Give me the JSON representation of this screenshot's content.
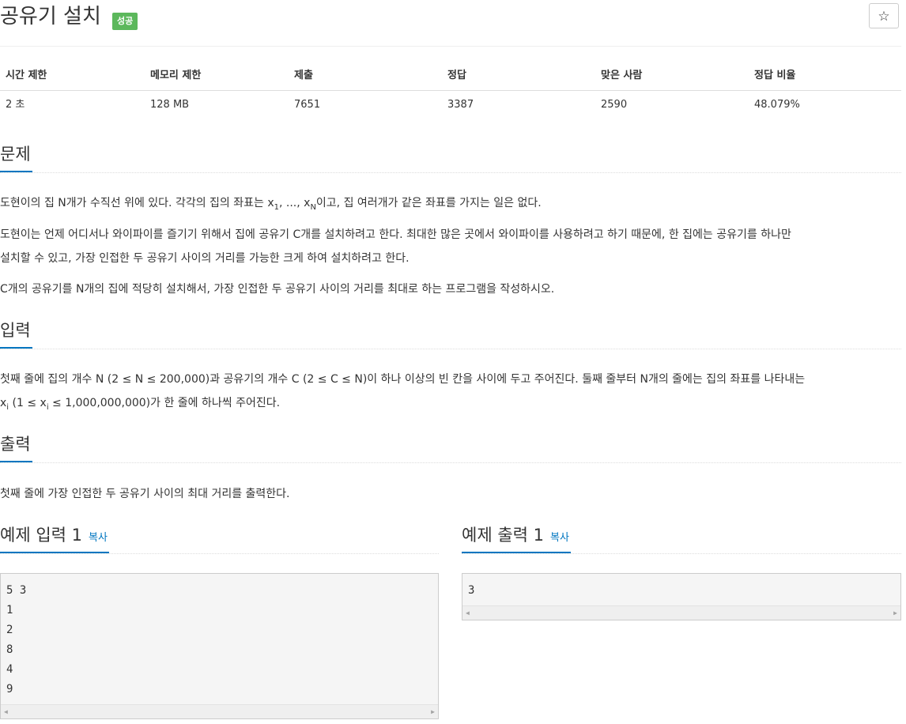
{
  "header": {
    "title": "공유기 설치",
    "badge": "성공",
    "star_icon": "☆"
  },
  "info_table": {
    "headers": [
      "시간 제한",
      "메모리 제한",
      "제출",
      "정답",
      "맞은 사람",
      "정답 비율"
    ],
    "values": [
      "2 초",
      "128 MB",
      "7651",
      "3387",
      "2590",
      "48.079%"
    ]
  },
  "sections": {
    "problem": {
      "title": "문제",
      "p1_a": "도현이의 집 N개가 수직선 위에 있다. 각각의 집의 좌표는 x",
      "p1_sub1": "1",
      "p1_b": ", ..., x",
      "p1_subN": "N",
      "p1_c": "이고, 집 여러개가 같은 좌표를 가지는 일은 없다.",
      "p2_line1": "도현이는 언제 어디서나 와이파이를 즐기기 위해서 집에 공유기 C개를 설치하려고 한다. 최대한 많은 곳에서 와이파이를 사용하려고 하기 때문에, 한 집에는 공유기를 하나만",
      "p2_line2": "설치할 수 있고, 가장 인접한 두 공유기 사이의 거리를 가능한 크게 하여 설치하려고 한다.",
      "p3": "C개의 공유기를 N개의 집에 적당히 설치해서, 가장 인접한 두 공유기 사이의 거리를 최대로 하는 프로그램을 작성하시오."
    },
    "input": {
      "title": "입력",
      "line1": "첫째 줄에 집의 개수 N (2 ≤ N ≤ 200,000)과 공유기의 개수 C (2 ≤ C ≤ N)이 하나 이상의 빈 칸을 사이에 두고 주어진다. 둘째 줄부터 N개의 줄에는 집의 좌표를 나타내는",
      "line2_a": "x",
      "line2_sub": "i",
      "line2_b": " (1 ≤ x",
      "line2_sub2": "i",
      "line2_c": " ≤ 1,000,000,000)가 한 줄에 하나씩 주어진다."
    },
    "output": {
      "title": "출력",
      "line1": "첫째 줄에 가장 인접한 두 공유기 사이의 최대 거리를 출력한다."
    }
  },
  "samples": {
    "input": {
      "title": "예제 입력 1",
      "copy_label": "복사",
      "content": "5 3\n1\n2\n8\n4\n9"
    },
    "output": {
      "title": "예제 출력 1",
      "copy_label": "복사",
      "content": "3"
    }
  }
}
